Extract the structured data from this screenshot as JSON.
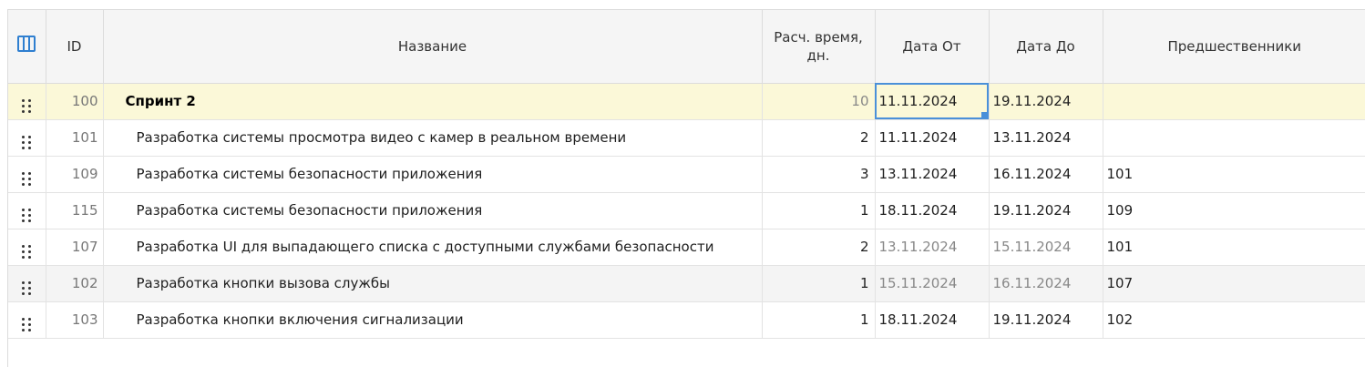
{
  "table": {
    "columns": {
      "settings_icon": "columns-icon",
      "id": "ID",
      "name": "Название",
      "estimate_line1": "Расч. время,",
      "estimate_line2": "дн.",
      "date_from": "Дата От",
      "date_to": "Дата До",
      "predecessors": "Предшественники"
    },
    "rows": [
      {
        "id": "100",
        "name": "Спринт 2",
        "estimate": "10",
        "date_from": "11.11.2024",
        "date_to": "19.11.2024",
        "predecessors": ""
      },
      {
        "id": "101",
        "name": "Разработка системы просмотра видео с камер в реальном времени",
        "estimate": "2",
        "date_from": "11.11.2024",
        "date_to": "13.11.2024",
        "predecessors": ""
      },
      {
        "id": "109",
        "name": "Разработка системы безопасности приложения",
        "estimate": "3",
        "date_from": "13.11.2024",
        "date_to": "16.11.2024",
        "predecessors": "101"
      },
      {
        "id": "115",
        "name": "Разработка системы безопасности приложения",
        "estimate": "1",
        "date_from": "18.11.2024",
        "date_to": "19.11.2024",
        "predecessors": "109"
      },
      {
        "id": "107",
        "name": "Разработка UI для выпадающего списка с доступными службами безопасности",
        "estimate": "2",
        "date_from": "13.11.2024",
        "date_to": "15.11.2024",
        "predecessors": "101"
      },
      {
        "id": "102",
        "name": "Разработка кнопки вызова службы",
        "estimate": "1",
        "date_from": "15.11.2024",
        "date_to": "16.11.2024",
        "predecessors": "107"
      },
      {
        "id": "103",
        "name": "Разработка кнопки включения сигнализации",
        "estimate": "1",
        "date_from": "18.11.2024",
        "date_to": "19.11.2024",
        "predecessors": "102"
      }
    ]
  },
  "colors": {
    "selected_row": "#fbf8d8",
    "accent": "#2f7fd0",
    "header_bg": "#f5f5f5"
  }
}
